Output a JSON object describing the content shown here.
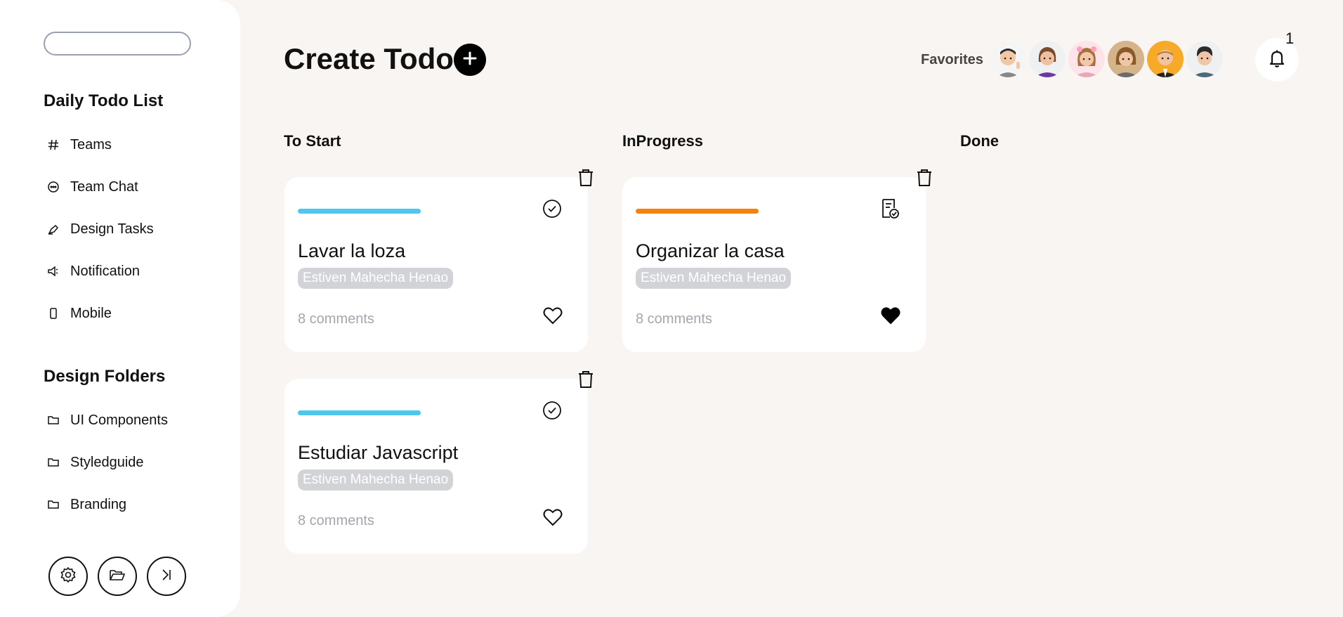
{
  "sidebar": {
    "search": {
      "placeholder": ""
    },
    "section1_title": "Daily Todo List",
    "nav": [
      {
        "label": "Teams",
        "icon": "hash-icon"
      },
      {
        "label": "Team Chat",
        "icon": "chat-icon"
      },
      {
        "label": "Design Tasks",
        "icon": "pen-icon"
      },
      {
        "label": "Notification",
        "icon": "megaphone-icon"
      },
      {
        "label": "Mobile",
        "icon": "mobile-icon"
      }
    ],
    "section2_title": "Design Folders",
    "folders": [
      {
        "label": "UI Components",
        "icon": "folder-icon"
      },
      {
        "label": "Styledguide",
        "icon": "folder-icon"
      },
      {
        "label": "Branding",
        "icon": "folder-icon"
      }
    ],
    "bottom_buttons": [
      "gear-icon",
      "folder-open-icon",
      "collapse-icon"
    ]
  },
  "header": {
    "title": "Create Todo",
    "favorites_label": "Favorites",
    "notification_count": "1"
  },
  "columns": [
    {
      "title": "To Start"
    },
    {
      "title": "InProgress"
    },
    {
      "title": "Done"
    }
  ],
  "cards": [
    {
      "title": "Lavar la loza",
      "assignee": "Estiven Mahecha Henao",
      "comments": "8 comments",
      "status": "to-start",
      "bar_color": "#4fc6ee",
      "favorite": false,
      "status_icon": "check-circle-icon"
    },
    {
      "title": "Estudiar Javascript",
      "assignee": "Estiven Mahecha Henao",
      "comments": "8 comments",
      "status": "to-start",
      "bar_color": "#4fc6ee",
      "favorite": false,
      "status_icon": "check-circle-icon"
    },
    {
      "title": "Organizar la casa",
      "assignee": "Estiven Mahecha Henao",
      "comments": "8 comments",
      "status": "in-progress",
      "bar_color": "#f5820d",
      "favorite": true,
      "status_icon": "task-list-icon"
    }
  ],
  "colors": {
    "background": "#f9f5f2",
    "to_start_bar": "#4fc6ee",
    "in_progress_bar": "#f5820d",
    "assignee_chip": "#d2d3d7"
  }
}
